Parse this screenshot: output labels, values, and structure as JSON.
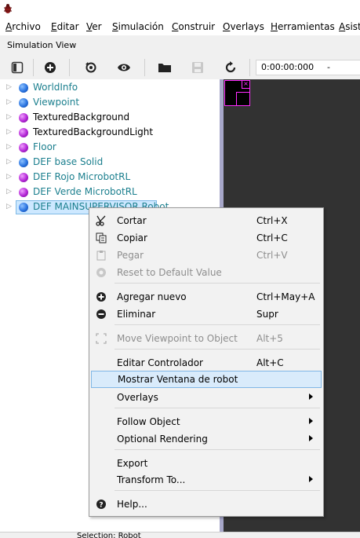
{
  "menubar": [
    "Archivo",
    "Editar",
    "Ver",
    "Simulación",
    "Construir",
    "Overlays",
    "Herramientas",
    "Asistente"
  ],
  "simulation_view_label": "Simulation View",
  "toolbar": {
    "time": "0:00:00:000",
    "dash": "-"
  },
  "tree": [
    {
      "label": "WorldInfo",
      "color": "blue",
      "style": "teal"
    },
    {
      "label": "Viewpoint",
      "color": "blue",
      "style": "teal"
    },
    {
      "label": "TexturedBackground",
      "color": "purple",
      "style": "plain"
    },
    {
      "label": "TexturedBackgroundLight",
      "color": "purple",
      "style": "plain"
    },
    {
      "label": "Floor",
      "color": "purple",
      "style": "teal"
    },
    {
      "label": "DEF base Solid",
      "color": "blue",
      "style": "teal"
    },
    {
      "label": "DEF Rojo MicrobotRL",
      "color": "purple",
      "style": "teal"
    },
    {
      "label": "DEF Verde MicrobotRL",
      "color": "purple",
      "style": "teal"
    },
    {
      "label": "DEF MAINSUPERVISOR Robot",
      "color": "blue",
      "style": "teal"
    }
  ],
  "context_menu": {
    "cut": {
      "label": "Cortar",
      "shortcut": "Ctrl+X"
    },
    "copy": {
      "label": "Copiar",
      "shortcut": "Ctrl+C"
    },
    "paste": {
      "label": "Pegar",
      "shortcut": "Ctrl+V"
    },
    "reset": {
      "label": "Reset to Default Value"
    },
    "add": {
      "label": "Agregar nuevo",
      "shortcut": "Ctrl+May+A"
    },
    "delete": {
      "label": "Eliminar",
      "shortcut": "Supr"
    },
    "move_viewpoint": {
      "label": "Move Viewpoint to Object",
      "shortcut": "Alt+5"
    },
    "edit_controller": {
      "label": "Editar Controlador",
      "shortcut": "Alt+C"
    },
    "show_robot_window": {
      "label": "Mostrar Ventana de robot"
    },
    "overlays": {
      "label": "Overlays"
    },
    "follow": {
      "label": "Follow Object"
    },
    "optional_rendering": {
      "label": "Optional Rendering"
    },
    "export": {
      "label": "Export"
    },
    "transform": {
      "label": "Transform To..."
    },
    "help": {
      "label": "Help..."
    }
  },
  "statusbar": {
    "text": "Selection: Robot"
  },
  "colors": {
    "accent_selection": "#cde8ff",
    "teal_text": "#1b7f8e",
    "view_bg": "#323232",
    "magenta": "#ff2cff"
  }
}
